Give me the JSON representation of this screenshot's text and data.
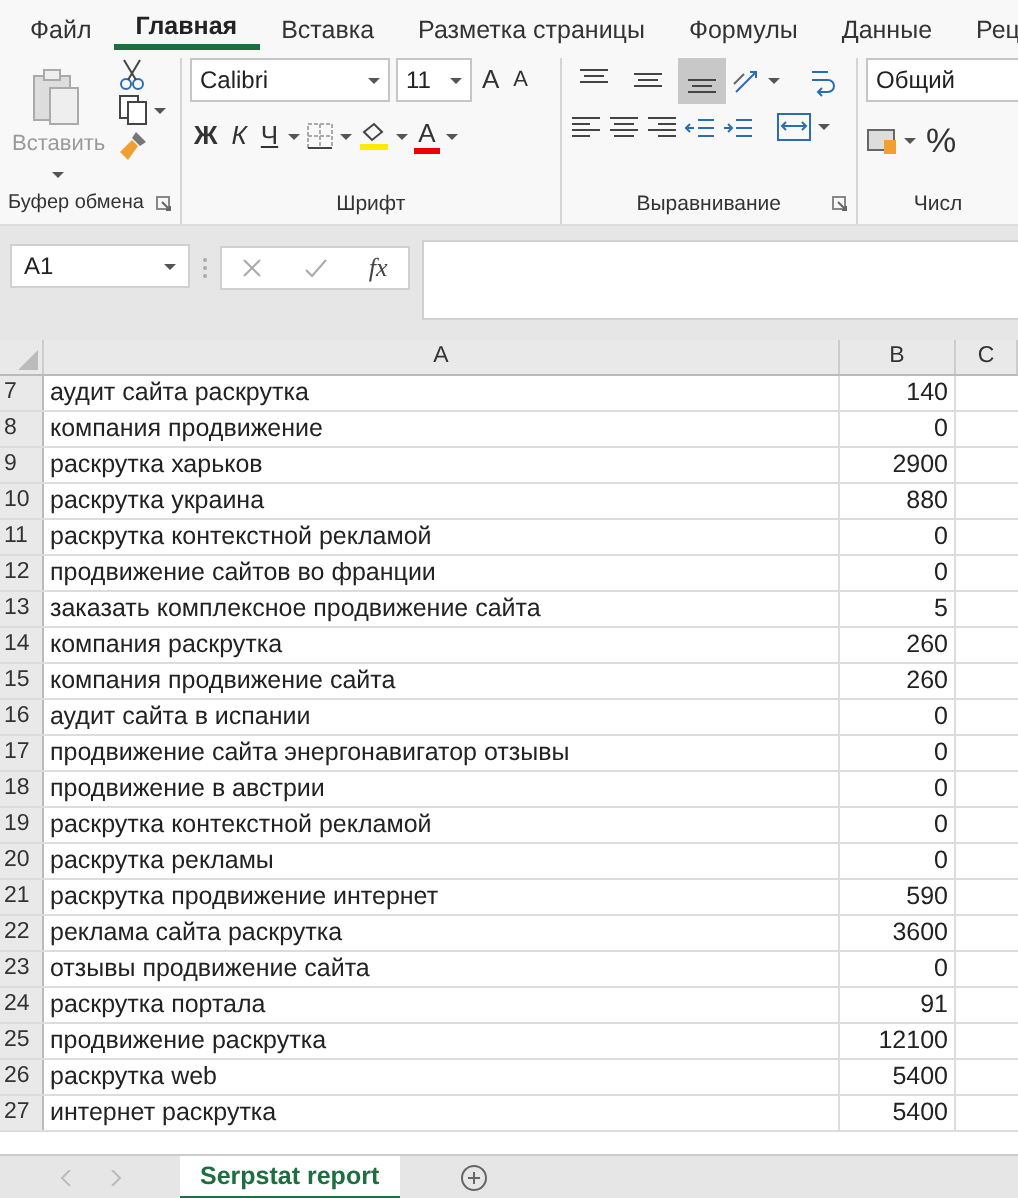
{
  "menu_tabs": [
    {
      "label": "Файл",
      "selected": false
    },
    {
      "label": "Главная",
      "selected": true
    },
    {
      "label": "Вставка",
      "selected": false
    },
    {
      "label": "Разметка страницы",
      "selected": false
    },
    {
      "label": "Формулы",
      "selected": false
    },
    {
      "label": "Данные",
      "selected": false
    },
    {
      "label": "Рец",
      "selected": false
    }
  ],
  "ribbon": {
    "clipboard": {
      "paste_label": "Вставить",
      "group_label": "Буфер обмена"
    },
    "font": {
      "font_name": "Calibri",
      "font_size": "11",
      "grow": "A",
      "shrink": "A",
      "bold": "Ж",
      "italic": "К",
      "underline": "Ч",
      "font_color": "A",
      "group_label": "Шрифт"
    },
    "alignment": {
      "vertical": [
        {
          "kind": "top",
          "selected": false
        },
        {
          "kind": "middle",
          "selected": false
        },
        {
          "kind": "bottom",
          "selected": true
        }
      ],
      "group_label": "Выравнивание"
    },
    "number": {
      "format": "Общий",
      "percent": "%",
      "group_label": "Числ"
    }
  },
  "formula_bar": {
    "name_box": "A1",
    "fx": "fx"
  },
  "sheet": {
    "columns": [
      "A",
      "B",
      "C"
    ],
    "rows": [
      {
        "number": "7",
        "a": "аудит сайта раскрутка",
        "b": "140"
      },
      {
        "number": "8",
        "a": "компания продвижение",
        "b": "0"
      },
      {
        "number": "9",
        "a": "раскрутка харьков",
        "b": "2900"
      },
      {
        "number": "10",
        "a": "раскрутка украина",
        "b": "880"
      },
      {
        "number": "11",
        "a": "раскрутка контекстной рекламой",
        "b": "0"
      },
      {
        "number": "12",
        "a": "продвижение сайтов во франции",
        "b": "0"
      },
      {
        "number": "13",
        "a": "заказать комплексное продвижение сайта",
        "b": "5"
      },
      {
        "number": "14",
        "a": "компания раскрутка",
        "b": "260"
      },
      {
        "number": "15",
        "a": "компания продвижение сайта",
        "b": "260"
      },
      {
        "number": "16",
        "a": "аудит сайта в испании",
        "b": "0"
      },
      {
        "number": "17",
        "a": "продвижение сайта энергонавигатор отзывы",
        "b": "0"
      },
      {
        "number": "18",
        "a": "продвижение в австрии",
        "b": "0"
      },
      {
        "number": "19",
        "a": "раскрутка контекстной рекламой",
        "b": "0"
      },
      {
        "number": "20",
        "a": "раскрутка рекламы",
        "b": "0"
      },
      {
        "number": "21",
        "a": "раскрутка продвижение интернет",
        "b": "590"
      },
      {
        "number": "22",
        "a": "реклама сайта раскрутка",
        "b": "3600"
      },
      {
        "number": "23",
        "a": "отзывы продвижение сайта",
        "b": "0"
      },
      {
        "number": "24",
        "a": "раскрутка портала",
        "b": "91"
      },
      {
        "number": "25",
        "a": "продвижение раскрутка",
        "b": "12100"
      },
      {
        "number": "26",
        "a": "раскрутка web",
        "b": "5400"
      },
      {
        "number": "27",
        "a": "интернет раскрутка",
        "b": "5400"
      }
    ]
  },
  "sheet_tabs": [
    {
      "label": "Serpstat report",
      "selected": true
    }
  ]
}
